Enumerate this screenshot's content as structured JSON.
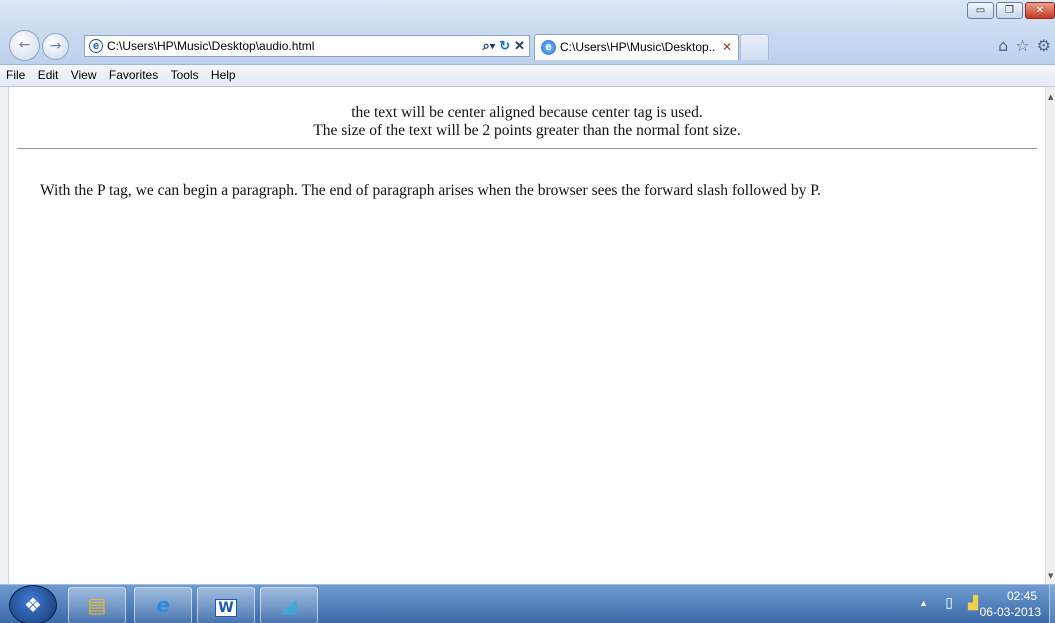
{
  "window": {
    "minimize_glyph": "▭",
    "restore_glyph": "❐",
    "close_glyph": "✕"
  },
  "nav": {
    "back_glyph": "←",
    "forward_glyph": "→"
  },
  "address_bar": {
    "url": "C:\\Users\\HP\\Music\\Desktop\\audio.html",
    "search_glyph": "⌕▾",
    "refresh_glyph": "↻",
    "stop_glyph": "✕"
  },
  "tab": {
    "label": "C:\\Users\\HP\\Music\\Desktop..",
    "close_glyph": "✕"
  },
  "toolbar_right": {
    "home_glyph": "⌂",
    "favorites_glyph": "☆",
    "settings_glyph": "⚙"
  },
  "menu": {
    "items": [
      "File",
      "Edit",
      "View",
      "Favorites",
      "Tools",
      "Help"
    ]
  },
  "page": {
    "center_line1": "the text will be center aligned because center tag is used.",
    "center_line2": "The size of the text will be 2 points greater than the normal font size.",
    "paragraph": "With the P tag, we can begin a paragraph. The end of paragraph arises when the browser sees the forward slash followed by P."
  },
  "taskbar": {
    "start_glyph": "❖",
    "files_glyph": "▤",
    "ie_glyph": "e",
    "word_glyph": "W",
    "paint_glyph": "◢",
    "time": "02:45",
    "date": "06-03-2013",
    "tray_arrow": "▲",
    "battery_glyph": "▯",
    "signal_glyph": "▟"
  },
  "colors": {
    "taskbar": "#3a6aa8",
    "chrome": "#c8daf0",
    "close_button": "#c5391e"
  }
}
